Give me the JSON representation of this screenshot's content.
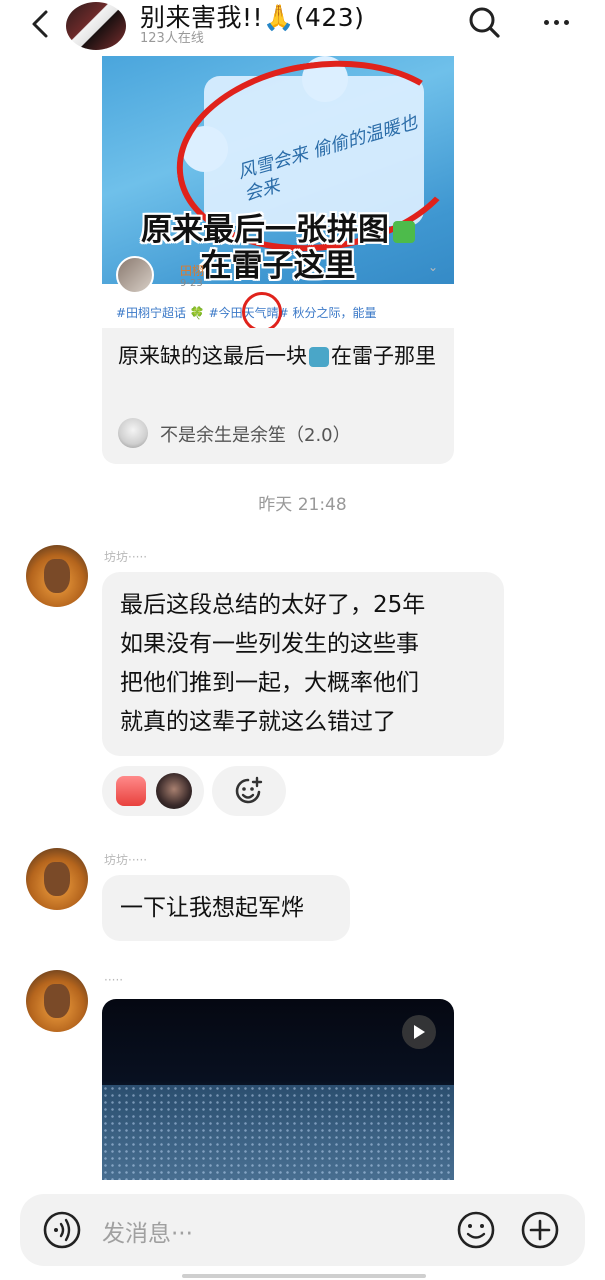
{
  "header": {
    "title": "别来害我!!🙏(423)",
    "online": "123人在线"
  },
  "shared_post": {
    "image_title_line1": "原来最后一张拼图",
    "image_title_line2": "在雷子这里",
    "handwriting": "风雪会来 偷偷的温暖也会来",
    "post_author": "田栩",
    "post_date": "9-23",
    "post_tags": "#田栩宁超话 🍀 #今田天气晴# 秋分之际，能量",
    "caption_part1": "原来缺的这最后一块",
    "caption_part2": "在雷子那里",
    "source_name": "不是余生是余笙（2.0）"
  },
  "time_divider": "昨天 21:48",
  "messages": [
    {
      "sender": "坊坊·····",
      "lines": [
        "最后这段总结的太好了，25年",
        "如果没有一些列发生的这些事",
        "把他们推到一起，大概率他们",
        "就真的这辈子就这么错过了"
      ]
    },
    {
      "sender": "坊坊·····",
      "lines": [
        "一下让我想起军烨"
      ]
    },
    {
      "sender": "·····",
      "video": true
    }
  ],
  "input": {
    "placeholder": "发消息···"
  },
  "colors": {
    "bubble": "#f2f2f2",
    "muted": "#999999",
    "annotation_red": "#e0221b",
    "link_blue": "#3a78c7"
  }
}
